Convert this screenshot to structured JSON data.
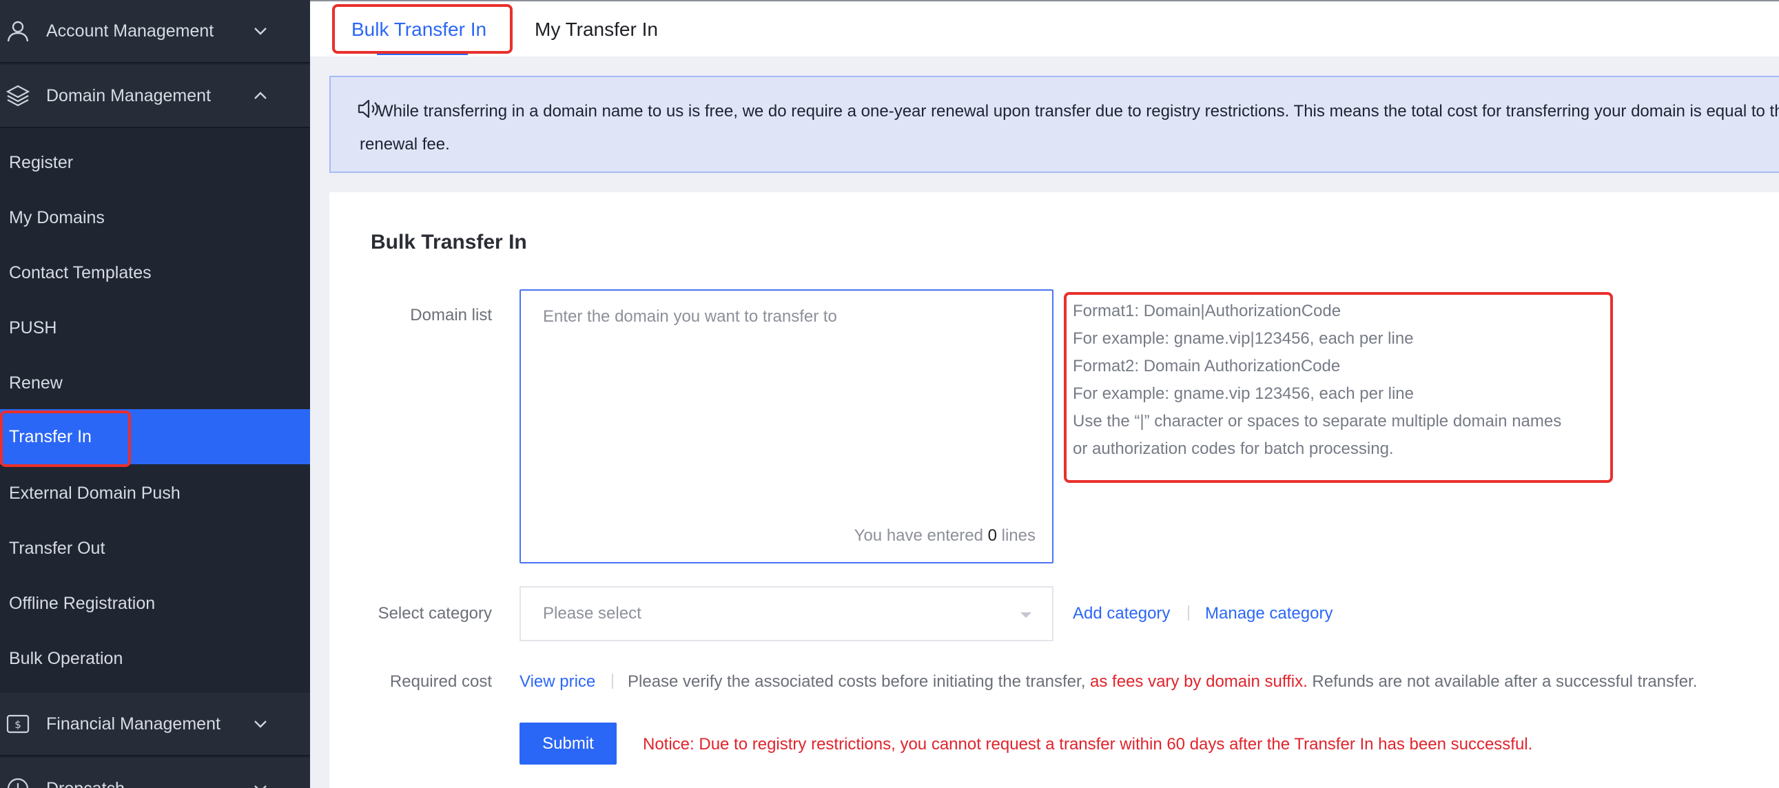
{
  "sidebar": {
    "account_management": "Account Management",
    "domain_management": "Domain Management",
    "items": [
      {
        "label": "Register"
      },
      {
        "label": "My Domains"
      },
      {
        "label": "Contact Templates"
      },
      {
        "label": "PUSH"
      },
      {
        "label": "Renew"
      },
      {
        "label": "Transfer In"
      },
      {
        "label": "External Domain Push"
      },
      {
        "label": "Transfer Out"
      },
      {
        "label": "Offline Registration"
      },
      {
        "label": "Bulk Operation"
      }
    ],
    "active_item": "Transfer In",
    "financial_management": "Financial Management",
    "dropcatch": "Dropcatch"
  },
  "tabs": [
    {
      "label": "Bulk Transfer In",
      "active": true
    },
    {
      "label": "My Transfer In",
      "active": false
    }
  ],
  "banner": {
    "text": "While transferring in a domain name to us is free, we do require a one-year renewal upon transfer due to registry restrictions. This means the total cost for transferring your domain is equal to the renewal fee."
  },
  "form": {
    "title": "Bulk Transfer In",
    "domain_list_label": "Domain list",
    "domain_list_placeholder": "Enter the domain you want to transfer to",
    "entered_prefix": "You have entered",
    "entered_count": "0",
    "entered_suffix": "lines",
    "hint_lines": [
      "Format1: Domain|AuthorizationCode",
      "For example: gname.vip|123456, each per line",
      "Format2: Domain AuthorizationCode",
      "For example: gname.vip 123456, each per line",
      "Use the “|” character or spaces to separate multiple domain names",
      "or authorization codes for batch processing."
    ],
    "category_label": "Select category",
    "category_placeholder": "Please select",
    "add_category": "Add category",
    "manage_category": "Manage category",
    "cost_label": "Required cost",
    "view_price": "View price",
    "cost_text_a": "Please verify the associated costs before initiating the transfer,",
    "cost_text_red": "as fees vary by domain suffix.",
    "cost_text_b": "Refunds are not available after a successful transfer.",
    "submit": "Submit",
    "notice": "Notice: Due to registry restrictions, you cannot request a transfer within 60 days after the Transfer In has been successful."
  },
  "colors": {
    "sidebar_bg": "#1f2531",
    "accent": "#2b67f6",
    "warning": "#e0242c",
    "highlight_box": "#e8302c"
  }
}
